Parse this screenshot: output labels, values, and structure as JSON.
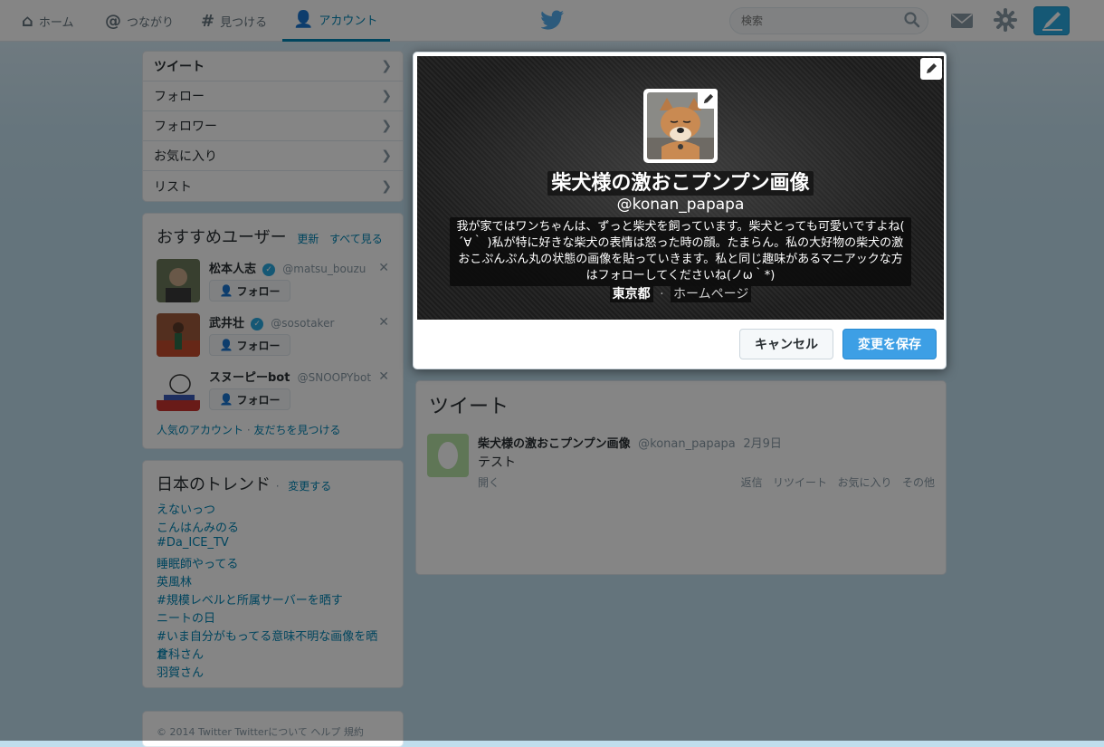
{
  "nav": {
    "home": "ホーム",
    "connect": "つながり",
    "discover": "見つける",
    "account": "アカウント"
  },
  "search": {
    "placeholder": "検索"
  },
  "profile_nav": {
    "items": [
      {
        "label": "ツイート"
      },
      {
        "label": "フォロー"
      },
      {
        "label": "フォロワー"
      },
      {
        "label": "お気に入り"
      },
      {
        "label": "リスト"
      }
    ]
  },
  "who_to_follow": {
    "title": "おすすめユーザー",
    "refresh": "更新",
    "view_all": "すべて見る",
    "follow_label": "フォロー",
    "users": [
      {
        "name": "松本人志",
        "screen_name": "@matsu_bouzu"
      },
      {
        "name": "武井壮",
        "screen_name": "@sosotaker"
      },
      {
        "name": "スヌーピーbot",
        "screen_name": "@SNOOPYbot"
      }
    ],
    "footer_popular": "人気のアカウント",
    "footer_find": "友だちを見つける"
  },
  "trends": {
    "title": "日本のトレンド",
    "change": "変更する",
    "items": [
      "えないっつ",
      "こんはんみのる",
      "#Da_ICE_TV",
      "睡眠師やってる",
      "英風林",
      "#規模レベルと所属サーバーを晒す",
      "ニートの日",
      "#いま自分がもってる意味不明な画像を晒せ",
      "倉科さん",
      "羽賀さん"
    ]
  },
  "footer": {
    "text": "© 2014 Twitter  Twitterについて  ヘルプ  規約"
  },
  "timeline": {
    "title": "ツイート",
    "tweet": {
      "name": "柴犬様の激おこプンプン画像",
      "screen_name": "@konan_papapa",
      "date": "2月9日",
      "text": "テスト",
      "expand": "開く",
      "reply": "返信",
      "retweet": "リツイート",
      "favorite": "お気に入り",
      "more": "その他"
    }
  },
  "modal": {
    "name": "柴犬様の激おこプンプン画像",
    "screen_name": "@konan_papapa",
    "bio": "我が家ではワンちゃんは、ずっと柴犬を飼っています。柴犬とっても可愛いですよね( ´∀｀ )私が特に好きな柴犬の表情は怒った時の顔。たまらん。私の大好物の柴犬の激おこぷんぷん丸の状態の画像を貼っていきます。私と同じ趣味があるマニアックな方はフォローしてくださいね(ノω｀*)",
    "location": "東京都",
    "separator": "·",
    "homepage": "ホームページ",
    "cancel": "キャンセル",
    "save": "変更を保存"
  },
  "colors": {
    "accent": "#0084b4",
    "save_button": "#3d9fe5",
    "background": "#c0deed"
  }
}
